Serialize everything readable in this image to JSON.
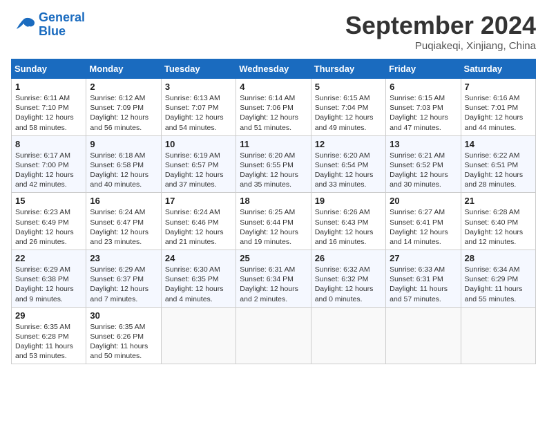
{
  "header": {
    "logo_line1": "General",
    "logo_line2": "Blue",
    "month": "September 2024",
    "location": "Puqiakeqi, Xinjiang, China"
  },
  "weekdays": [
    "Sunday",
    "Monday",
    "Tuesday",
    "Wednesday",
    "Thursday",
    "Friday",
    "Saturday"
  ],
  "weeks": [
    [
      {
        "day": "1",
        "sunrise": "6:11 AM",
        "sunset": "7:10 PM",
        "daylight": "12 hours and 58 minutes."
      },
      {
        "day": "2",
        "sunrise": "6:12 AM",
        "sunset": "7:09 PM",
        "daylight": "12 hours and 56 minutes."
      },
      {
        "day": "3",
        "sunrise": "6:13 AM",
        "sunset": "7:07 PM",
        "daylight": "12 hours and 54 minutes."
      },
      {
        "day": "4",
        "sunrise": "6:14 AM",
        "sunset": "7:06 PM",
        "daylight": "12 hours and 51 minutes."
      },
      {
        "day": "5",
        "sunrise": "6:15 AM",
        "sunset": "7:04 PM",
        "daylight": "12 hours and 49 minutes."
      },
      {
        "day": "6",
        "sunrise": "6:15 AM",
        "sunset": "7:03 PM",
        "daylight": "12 hours and 47 minutes."
      },
      {
        "day": "7",
        "sunrise": "6:16 AM",
        "sunset": "7:01 PM",
        "daylight": "12 hours and 44 minutes."
      }
    ],
    [
      {
        "day": "8",
        "sunrise": "6:17 AM",
        "sunset": "7:00 PM",
        "daylight": "12 hours and 42 minutes."
      },
      {
        "day": "9",
        "sunrise": "6:18 AM",
        "sunset": "6:58 PM",
        "daylight": "12 hours and 40 minutes."
      },
      {
        "day": "10",
        "sunrise": "6:19 AM",
        "sunset": "6:57 PM",
        "daylight": "12 hours and 37 minutes."
      },
      {
        "day": "11",
        "sunrise": "6:20 AM",
        "sunset": "6:55 PM",
        "daylight": "12 hours and 35 minutes."
      },
      {
        "day": "12",
        "sunrise": "6:20 AM",
        "sunset": "6:54 PM",
        "daylight": "12 hours and 33 minutes."
      },
      {
        "day": "13",
        "sunrise": "6:21 AM",
        "sunset": "6:52 PM",
        "daylight": "12 hours and 30 minutes."
      },
      {
        "day": "14",
        "sunrise": "6:22 AM",
        "sunset": "6:51 PM",
        "daylight": "12 hours and 28 minutes."
      }
    ],
    [
      {
        "day": "15",
        "sunrise": "6:23 AM",
        "sunset": "6:49 PM",
        "daylight": "12 hours and 26 minutes."
      },
      {
        "day": "16",
        "sunrise": "6:24 AM",
        "sunset": "6:47 PM",
        "daylight": "12 hours and 23 minutes."
      },
      {
        "day": "17",
        "sunrise": "6:24 AM",
        "sunset": "6:46 PM",
        "daylight": "12 hours and 21 minutes."
      },
      {
        "day": "18",
        "sunrise": "6:25 AM",
        "sunset": "6:44 PM",
        "daylight": "12 hours and 19 minutes."
      },
      {
        "day": "19",
        "sunrise": "6:26 AM",
        "sunset": "6:43 PM",
        "daylight": "12 hours and 16 minutes."
      },
      {
        "day": "20",
        "sunrise": "6:27 AM",
        "sunset": "6:41 PM",
        "daylight": "12 hours and 14 minutes."
      },
      {
        "day": "21",
        "sunrise": "6:28 AM",
        "sunset": "6:40 PM",
        "daylight": "12 hours and 12 minutes."
      }
    ],
    [
      {
        "day": "22",
        "sunrise": "6:29 AM",
        "sunset": "6:38 PM",
        "daylight": "12 hours and 9 minutes."
      },
      {
        "day": "23",
        "sunrise": "6:29 AM",
        "sunset": "6:37 PM",
        "daylight": "12 hours and 7 minutes."
      },
      {
        "day": "24",
        "sunrise": "6:30 AM",
        "sunset": "6:35 PM",
        "daylight": "12 hours and 4 minutes."
      },
      {
        "day": "25",
        "sunrise": "6:31 AM",
        "sunset": "6:34 PM",
        "daylight": "12 hours and 2 minutes."
      },
      {
        "day": "26",
        "sunrise": "6:32 AM",
        "sunset": "6:32 PM",
        "daylight": "12 hours and 0 minutes."
      },
      {
        "day": "27",
        "sunrise": "6:33 AM",
        "sunset": "6:31 PM",
        "daylight": "11 hours and 57 minutes."
      },
      {
        "day": "28",
        "sunrise": "6:34 AM",
        "sunset": "6:29 PM",
        "daylight": "11 hours and 55 minutes."
      }
    ],
    [
      {
        "day": "29",
        "sunrise": "6:35 AM",
        "sunset": "6:28 PM",
        "daylight": "11 hours and 53 minutes."
      },
      {
        "day": "30",
        "sunrise": "6:35 AM",
        "sunset": "6:26 PM",
        "daylight": "11 hours and 50 minutes."
      },
      null,
      null,
      null,
      null,
      null
    ]
  ]
}
